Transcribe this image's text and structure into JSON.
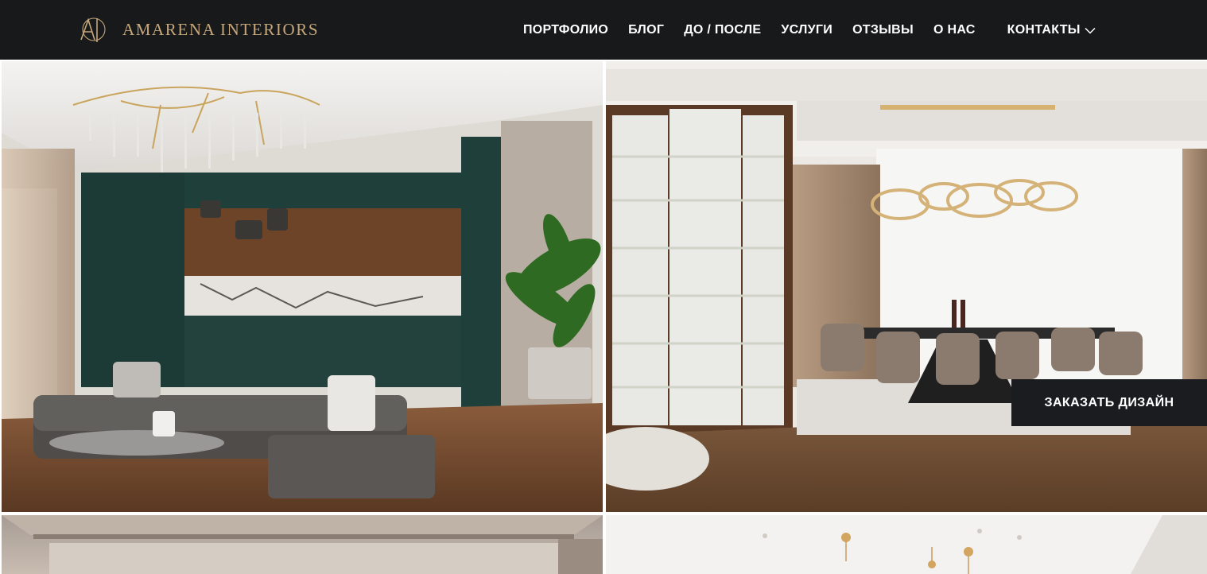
{
  "brand": {
    "monogram": "AI",
    "name": "AMARENA INTERIORS",
    "gold": "#c7a77a"
  },
  "nav": {
    "items": [
      "ПОРТФОЛИО",
      "БЛОГ",
      "ДО / ПОСЛЕ",
      "УСЛУГИ",
      "ОТЗЫВЫ",
      "О НАС"
    ],
    "contacts": "КОНТАКТЫ",
    "contacts_icon": "chevron-down-icon"
  },
  "cta": {
    "label": "ЗАКАЗАТЬ ДИЗАЙН"
  },
  "colors": {
    "header_bg": "#18191b",
    "cta_bg": "#1b1c1f",
    "text_light": "#ffffff"
  },
  "portfolio": {
    "tiles": [
      {
        "subject": "living-room-kitchen"
      },
      {
        "subject": "dining-room-vitrine"
      },
      {
        "subject": "interior-ceiling"
      },
      {
        "subject": "interior-ceiling-lights"
      }
    ]
  }
}
